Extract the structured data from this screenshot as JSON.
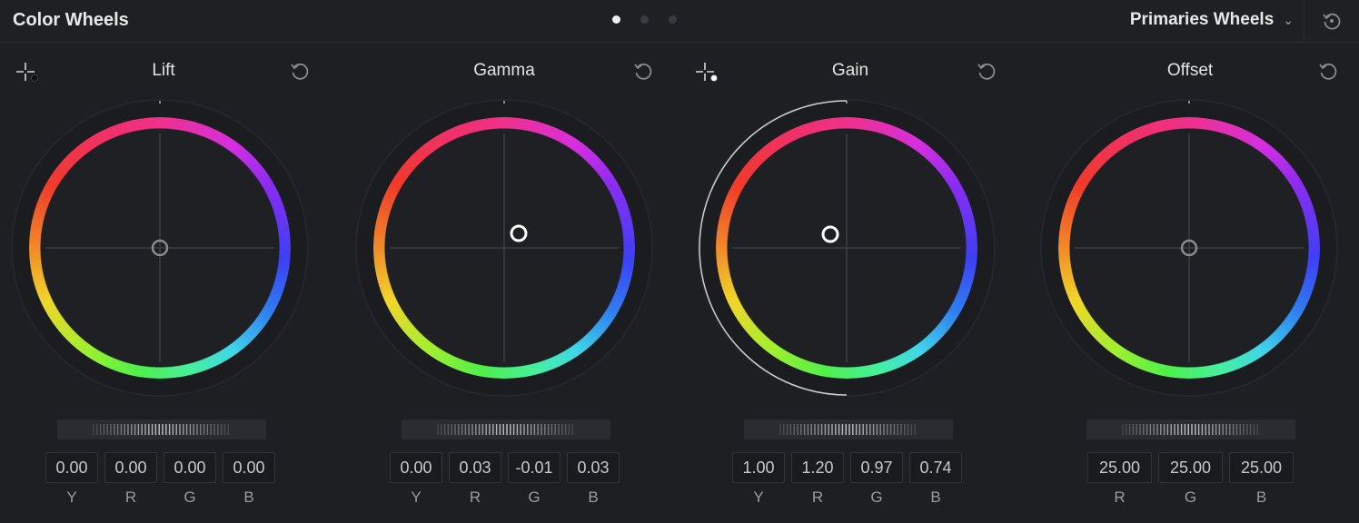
{
  "header": {
    "title": "Color Wheels",
    "page_dots": [
      true,
      false,
      false
    ],
    "mode_label": "Primaries Wheels",
    "mode_icon": "chevron-down-icon",
    "reset_icon": "reset-all-icon"
  },
  "colors": {
    "background": "#1e1f23",
    "value_box": "#1a1b1f"
  },
  "wheels": [
    {
      "id": "lift",
      "title": "Lift",
      "has_picker": true,
      "values": [
        {
          "label": "Y",
          "value": "0.00"
        },
        {
          "label": "R",
          "value": "0.00"
        },
        {
          "label": "G",
          "value": "0.00"
        },
        {
          "label": "B",
          "value": "0.00"
        }
      ]
    },
    {
      "id": "gamma",
      "title": "Gamma",
      "has_picker": false,
      "values": [
        {
          "label": "Y",
          "value": "0.00"
        },
        {
          "label": "R",
          "value": "0.03"
        },
        {
          "label": "G",
          "value": "-0.01"
        },
        {
          "label": "B",
          "value": "0.03"
        }
      ]
    },
    {
      "id": "gain",
      "title": "Gain",
      "has_picker": true,
      "values": [
        {
          "label": "Y",
          "value": "1.00"
        },
        {
          "label": "R",
          "value": "1.20"
        },
        {
          "label": "G",
          "value": "0.97"
        },
        {
          "label": "B",
          "value": "0.74"
        }
      ]
    },
    {
      "id": "offset",
      "title": "Offset",
      "has_picker": false,
      "values": [
        {
          "label": "R",
          "value": "25.00"
        },
        {
          "label": "G",
          "value": "25.00"
        },
        {
          "label": "B",
          "value": "25.00"
        }
      ]
    }
  ]
}
